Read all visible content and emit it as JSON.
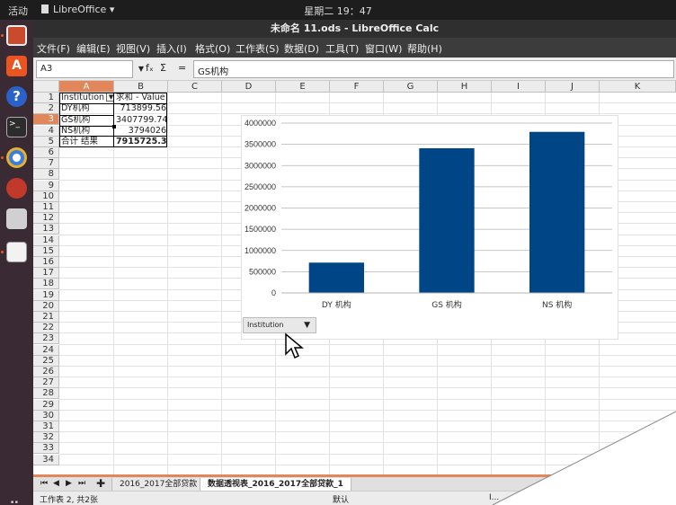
{
  "topbar": {
    "activities": "活动",
    "app": "LibreOffice ▾",
    "clock": "星期二 19：47"
  },
  "window": {
    "title": "未命名 11.ods - LibreOffice Calc"
  },
  "menu": [
    "文件(F)",
    "编辑(E)",
    "视图(V)",
    "插入(I)",
    "格式(O)",
    "工作表(S)",
    "数据(D)",
    "工具(T)",
    "窗口(W)",
    "帮助(H)"
  ],
  "formula_bar": {
    "cell_ref": "A3",
    "fx": "fₓ",
    "sigma": "Σ",
    "equals": "=",
    "content": "GS机构"
  },
  "columns": [
    "A",
    "B",
    "C",
    "D",
    "E",
    "F",
    "G",
    "H",
    "I",
    "J",
    "K"
  ],
  "rows": [
    "1",
    "2",
    "3",
    "4",
    "5",
    "6",
    "7",
    "8",
    "9",
    "10",
    "11",
    "12",
    "13",
    "14",
    "15",
    "16",
    "17",
    "18",
    "19",
    "20",
    "21",
    "22",
    "23",
    "24",
    "25",
    "26",
    "27",
    "28",
    "29",
    "30",
    "31",
    "32",
    "33",
    "34"
  ],
  "pivot": {
    "header_a": "Institution",
    "header_b": "求和 - Value",
    "rows": [
      {
        "label": "DY机构",
        "value": "713899.56"
      },
      {
        "label": "GS机构",
        "value": "3407799.74"
      },
      {
        "label": "NS机构",
        "value": "3794026"
      }
    ],
    "total_label": "合计 结果",
    "total_value": "7915725.3"
  },
  "chart_data": {
    "type": "bar",
    "categories": [
      "DY 机构",
      "GS 机构",
      "NS 机构"
    ],
    "values": [
      713899.56,
      3407799.74,
      3794026
    ],
    "yticks": [
      "0",
      "500000",
      "1000000",
      "1500000",
      "2000000",
      "2500000",
      "3000000",
      "3500000",
      "4000000"
    ],
    "ylim": [
      0,
      4000000
    ],
    "color": "#004586",
    "grid": true,
    "field_button": "Institution"
  },
  "tabs": {
    "sheet1": "2016_2017全部贷款",
    "sheet2": "数据透视表_2016_2017全部贷款_1"
  },
  "status": {
    "sheet_info": "工作表 2, 共2张",
    "style": "默认",
    "mode": "I..."
  }
}
